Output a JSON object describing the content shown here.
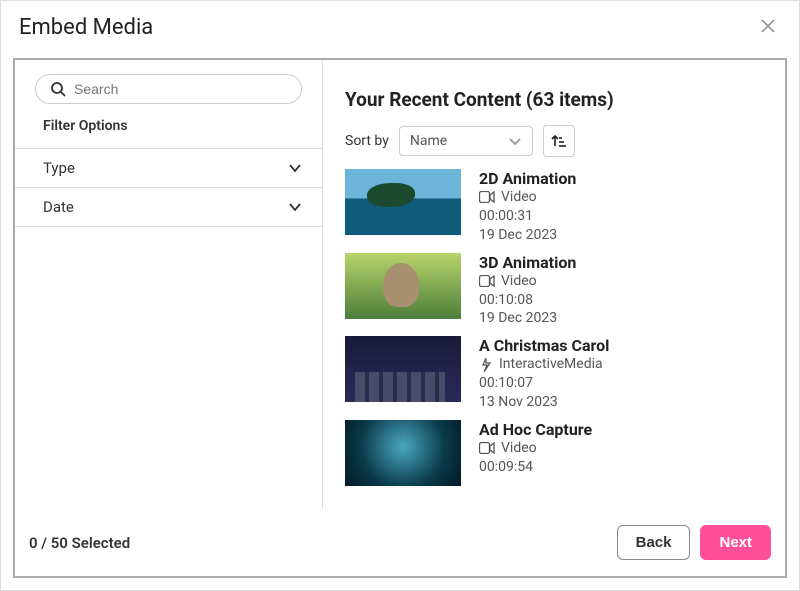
{
  "modal": {
    "title": "Embed Media"
  },
  "sidebar": {
    "search_placeholder": "Search",
    "filter_title": "Filter Options",
    "filters": [
      {
        "label": "Type"
      },
      {
        "label": "Date"
      }
    ]
  },
  "content": {
    "heading": "Your Recent Content (63 items)",
    "sort_label": "Sort by",
    "sort_value": "Name"
  },
  "items": [
    {
      "title": "2D Animation",
      "type": "Video",
      "duration": "00:00:31",
      "date": "19 Dec 2023"
    },
    {
      "title": "3D Animation",
      "type": "Video",
      "duration": "00:10:08",
      "date": "19 Dec 2023"
    },
    {
      "title": "A Christmas Carol",
      "type": "InteractiveMedia",
      "duration": "00:10:07",
      "date": "13 Nov 2023"
    },
    {
      "title": "Ad Hoc Capture",
      "type": "Video",
      "duration": "00:09:54",
      "date": ""
    }
  ],
  "footer": {
    "selected": "0 / 50 Selected",
    "back": "Back",
    "next": "Next"
  }
}
